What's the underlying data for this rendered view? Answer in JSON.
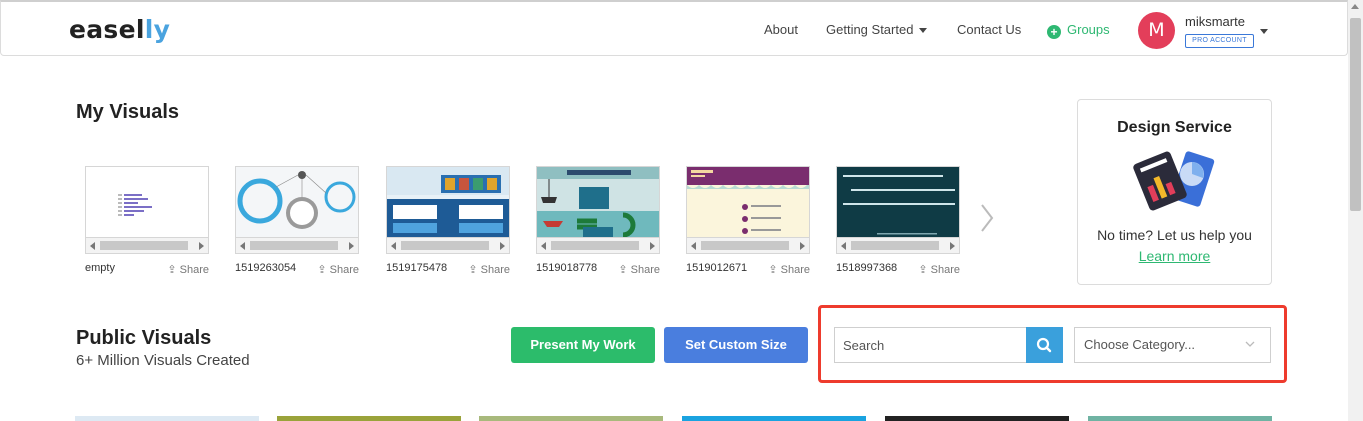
{
  "brand": {
    "logo_main": "easel",
    "logo_accent": "ly"
  },
  "nav": {
    "about": "About",
    "getting_started": "Getting Started",
    "contact": "Contact Us",
    "groups": "Groups",
    "avatar_letter": "M",
    "username": "miksmarte",
    "badge": "PRO ACCOUNT"
  },
  "my_visuals": {
    "title": "My Visuals",
    "share_label": "Share",
    "items": [
      {
        "name": "empty"
      },
      {
        "name": "1519263054"
      },
      {
        "name": "1519175478"
      },
      {
        "name": "1519018778"
      },
      {
        "name": "1519012671"
      },
      {
        "name": "1518997368"
      }
    ]
  },
  "design_service": {
    "title": "Design Service",
    "text": "No time? Let us help you",
    "link": "Learn more"
  },
  "public_visuals": {
    "title": "Public Visuals",
    "subtitle": "6+ Million Visuals Created",
    "present_button": "Present My Work",
    "custom_size_button": "Set Custom Size",
    "search_placeholder": "Search",
    "category_select": "Choose Category..."
  },
  "colors": {
    "accent_green": "#2cbc6b",
    "accent_blue": "#4a7ede",
    "search_blue": "#3aa0dc",
    "highlight_red": "#ee3b2d",
    "avatar_red": "#e33e5a",
    "tiles": [
      "#dde9f3",
      "#9aa33a",
      "#a8b97c",
      "#1aa3e0",
      "#222222",
      "#6fb3a3"
    ]
  }
}
